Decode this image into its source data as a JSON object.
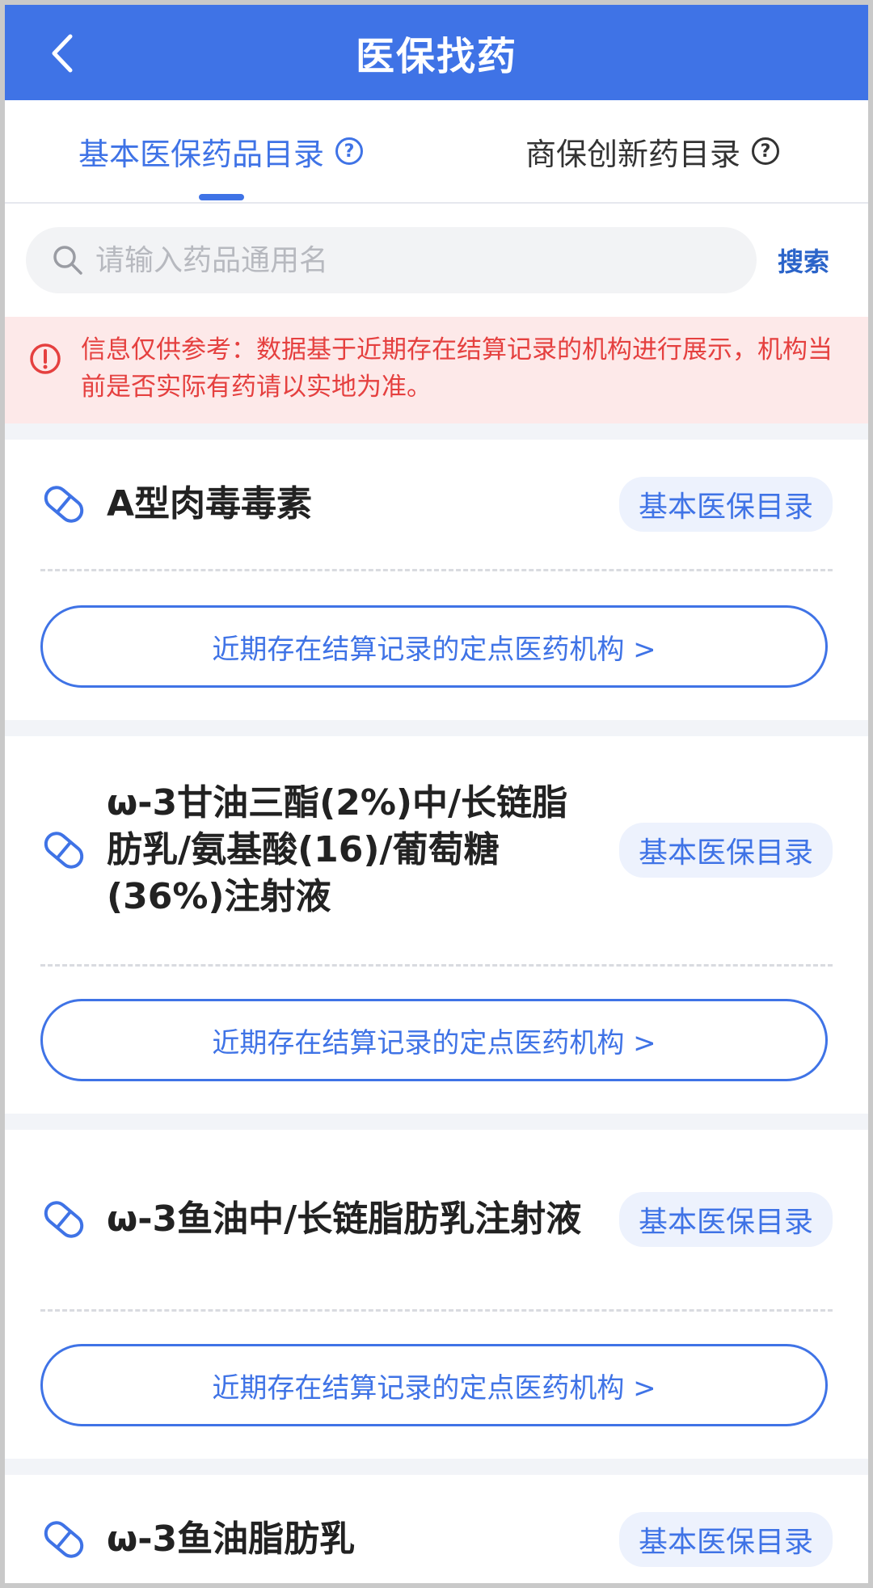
{
  "header": {
    "title": "医保找药"
  },
  "tabs": [
    {
      "label": "基本医保药品目录",
      "help": "?"
    },
    {
      "label": "商保创新药目录",
      "help": "?"
    }
  ],
  "search": {
    "placeholder": "请输入药品通用名",
    "value": "",
    "button_label": "搜索"
  },
  "notice": {
    "text": "信息仅供参考：数据基于近期存在结算记录的机构进行展示，机构当前是否实际有药请以实地为准。"
  },
  "drugs": [
    {
      "name": "A型肉毒毒素",
      "badge": "基本医保目录",
      "org_link": "近期存在结算记录的定点医药机构 >"
    },
    {
      "name": "ω-3甘油三酯(2%)中/长链脂肪乳/氨基酸(16)/葡萄糖(36%)注射液",
      "badge": "基本医保目录",
      "org_link": "近期存在结算记录的定点医药机构 >"
    },
    {
      "name": "ω-3鱼油中/长链脂肪乳注射液",
      "badge": "基本医保目录",
      "org_link": "近期存在结算记录的定点医药机构 >"
    },
    {
      "name": "ω-3鱼油脂肪乳",
      "badge": "基本医保目录",
      "org_link": ""
    }
  ],
  "colors": {
    "primary": "#3f73e6",
    "warning": "#e5403f",
    "notice_bg": "#fde9e9"
  },
  "icons": {
    "back": "chevron-left-icon",
    "help": "question-circle-icon",
    "search": "search-icon",
    "info": "info-circle-icon",
    "drug": "pill-icon"
  }
}
